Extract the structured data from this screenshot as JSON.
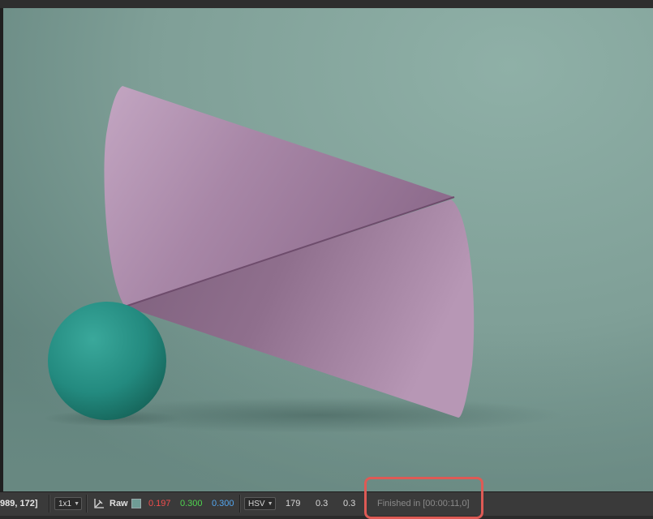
{
  "statusbar": {
    "pixel_coords": "989, 172]",
    "zoom_ratio": "1x1",
    "color_mode_label": "Raw",
    "rgb": {
      "r": "0.197",
      "g": "0.300",
      "b": "0.300"
    },
    "color_space": "HSV",
    "hsv": {
      "h": "179",
      "s": "0.3",
      "v": "0.3"
    },
    "render_status": "Finished in [00:00:11,0]"
  },
  "colors": {
    "swatch": "#6f9c95",
    "red_channel": "#f04d4d",
    "green_channel": "#4fd64f",
    "blue_channel": "#53a6f0",
    "highlight": "#de5a55"
  },
  "icons": {
    "picker": "eyedropper-icon",
    "dropdown": "chevron-down-icon"
  }
}
